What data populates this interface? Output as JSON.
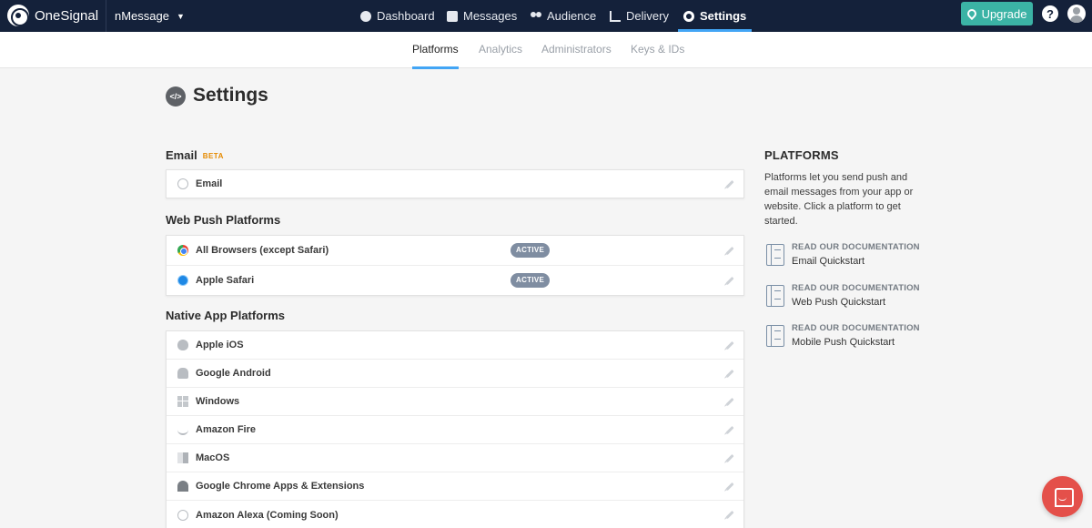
{
  "topnav": {
    "brand": "OneSignal",
    "app_name": "nMessage",
    "items": [
      {
        "label": "Dashboard",
        "icon": "dashboard-icon"
      },
      {
        "label": "Messages",
        "icon": "messages-icon"
      },
      {
        "label": "Audience",
        "icon": "audience-icon"
      },
      {
        "label": "Delivery",
        "icon": "delivery-icon"
      },
      {
        "label": "Settings",
        "icon": "gear-icon",
        "active": true
      }
    ],
    "upgrade_label": "Upgrade",
    "help_label": "?"
  },
  "subnav": {
    "tabs": [
      {
        "label": "Platforms",
        "active": true
      },
      {
        "label": "Analytics"
      },
      {
        "label": "Administrators"
      },
      {
        "label": "Keys & IDs"
      }
    ]
  },
  "page": {
    "title": "Settings",
    "title_icon_glyph": "</>"
  },
  "sections": {
    "email": {
      "heading": "Email",
      "badge": "BETA",
      "rows": [
        {
          "label": "Email",
          "icon": "at-icon"
        }
      ]
    },
    "web_push": {
      "heading": "Web Push Platforms",
      "rows": [
        {
          "label": "All Browsers (except Safari)",
          "icon": "chrome-icon",
          "status": "ACTIVE"
        },
        {
          "label": "Apple Safari",
          "icon": "safari-icon",
          "status": "ACTIVE"
        }
      ]
    },
    "native": {
      "heading": "Native App Platforms",
      "rows": [
        {
          "label": "Apple iOS",
          "icon": "apple-icon"
        },
        {
          "label": "Google Android",
          "icon": "android-icon"
        },
        {
          "label": "Windows",
          "icon": "windows-icon"
        },
        {
          "label": "Amazon Fire",
          "icon": "amazon-icon"
        },
        {
          "label": "MacOS",
          "icon": "macos-icon"
        },
        {
          "label": "Google Chrome Apps & Extensions",
          "icon": "chrome-apps-icon"
        },
        {
          "label": "Amazon Alexa (Coming Soon)",
          "icon": "alexa-icon"
        }
      ]
    }
  },
  "sidebar": {
    "title": "PLATFORMS",
    "description": "Platforms let you send push and email messages from your app or website. Click a platform to get started.",
    "docs": [
      {
        "label": "READ OUR DOCUMENTATION",
        "link": "Email Quickstart"
      },
      {
        "label": "READ OUR DOCUMENTATION",
        "link": "Web Push Quickstart"
      },
      {
        "label": "READ OUR DOCUMENTATION",
        "link": "Mobile Push Quickstart"
      }
    ]
  },
  "colors": {
    "nav_bg": "#14213a",
    "accent_blue": "#42a5f5",
    "upgrade_teal": "#3bb3a5",
    "active_badge": "#7f8da1",
    "beta_orange": "#e58a00",
    "chat_red": "#e4504a"
  }
}
